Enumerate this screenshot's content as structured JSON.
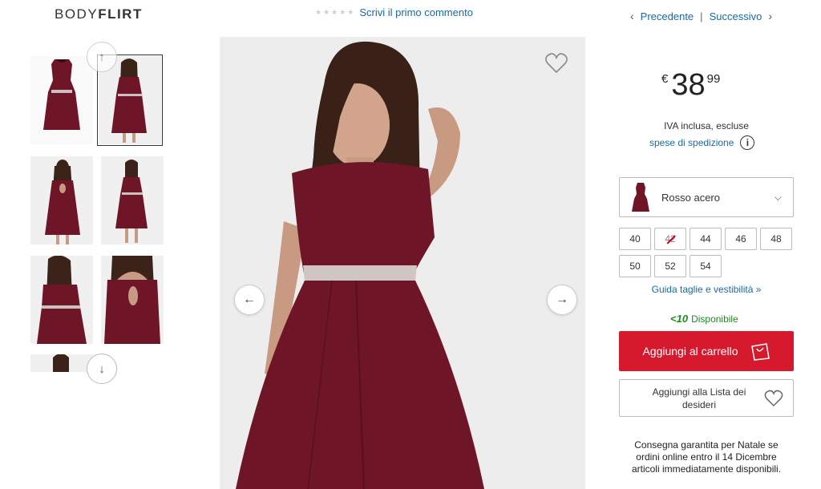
{
  "header": {
    "brand_light": "BODY",
    "brand_bold": "FLIRT",
    "review_link": "Scrivi il primo commento",
    "prev_label": "Precedente",
    "separator": "|",
    "next_label": "Successivo"
  },
  "product": {
    "price": {
      "currency": "€",
      "integer": "38",
      "decimal": "99"
    },
    "vat_note": "IVA inclusa, escluse",
    "shipping_link": "spese di spedizione",
    "color": {
      "name": "Rosso acero",
      "swatch_hex": "#6e1528"
    },
    "sizes": [
      {
        "label": "40",
        "available": true
      },
      {
        "label": "42",
        "available": false
      },
      {
        "label": "44",
        "available": true
      },
      {
        "label": "46",
        "available": true
      },
      {
        "label": "48",
        "available": true
      },
      {
        "label": "50",
        "available": true
      },
      {
        "label": "52",
        "available": true
      },
      {
        "label": "54",
        "available": true
      }
    ],
    "size_guide_link": "Guida taglie e vestibilità »",
    "availability_qty": "<10",
    "availability_label": "Disponibile",
    "add_to_cart": "Aggiungi al carrello",
    "add_to_wishlist_line1": "Aggiungi alla Lista dei",
    "add_to_wishlist_line2": "desideri",
    "delivery_line1": "Consegna garantita per Natale se",
    "delivery_line2": "ordini online entro il 14 Dicembre",
    "delivery_line3": "articoli immediatamente disponibili."
  },
  "colors": {
    "accent_red": "#d7192d",
    "link_blue": "#1a6aa5",
    "available_green": "#1f8a1f",
    "dress_burgundy": "#6e1528"
  },
  "icons": {
    "favorite": "heart-outline-icon",
    "prev_arrow": "arrow-left-icon",
    "next_arrow": "arrow-right-icon",
    "thumb_up": "arrow-up-icon",
    "thumb_down": "arrow-down-icon",
    "info": "info-icon",
    "cart": "shopping-bag-icon",
    "wishlist": "heart-icon",
    "dropdown": "chevron-down-icon"
  }
}
